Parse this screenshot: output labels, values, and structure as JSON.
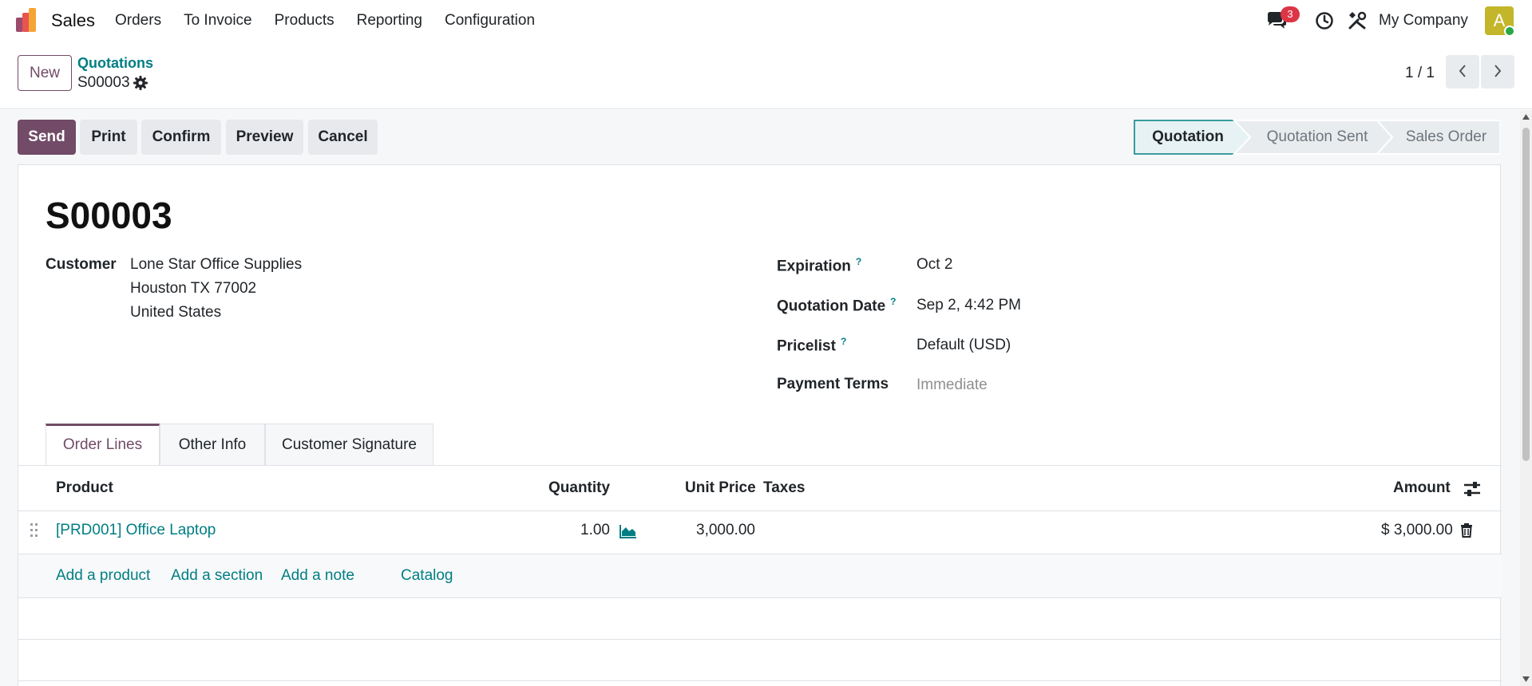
{
  "navbar": {
    "app_name": "Sales",
    "menu": [
      "Orders",
      "To Invoice",
      "Products",
      "Reporting",
      "Configuration"
    ],
    "messages_badge": "3",
    "company": "My Company",
    "avatar_letter": "A"
  },
  "control_panel": {
    "new_label": "New",
    "breadcrumb_parent": "Quotations",
    "breadcrumb_current": "S00003",
    "pager": "1 / 1"
  },
  "actions": {
    "send": "Send",
    "print": "Print",
    "confirm": "Confirm",
    "preview": "Preview",
    "cancel": "Cancel"
  },
  "statusbar": {
    "stages": [
      "Quotation",
      "Quotation Sent",
      "Sales Order"
    ],
    "active": "Quotation"
  },
  "form": {
    "title": "S00003",
    "customer_label": "Customer",
    "customer_name": "Lone Star Office Supplies",
    "customer_address_1": "Houston TX 77002",
    "customer_address_2": "United States",
    "expiration_label": "Expiration",
    "expiration_value": "Oct 2",
    "quotation_date_label": "Quotation Date",
    "quotation_date_value": "Sep 2, 4:42 PM",
    "pricelist_label": "Pricelist",
    "pricelist_value": "Default (USD)",
    "payment_terms_label": "Payment Terms",
    "payment_terms_placeholder": "Immediate",
    "help_mark": "?"
  },
  "tabs": [
    "Order Lines",
    "Other Info",
    "Customer Signature"
  ],
  "order_lines": {
    "columns": {
      "product": "Product",
      "quantity": "Quantity",
      "unit_price": "Unit Price",
      "taxes": "Taxes",
      "amount": "Amount"
    },
    "rows": [
      {
        "product": "[PRD001] Office Laptop",
        "quantity": "1.00",
        "unit_price": "3,000.00",
        "taxes": "",
        "amount": "$ 3,000.00"
      }
    ],
    "add_product": "Add a product",
    "add_section": "Add a section",
    "add_note": "Add a note",
    "catalog": "Catalog"
  },
  "colors": {
    "primary": "#714b67",
    "link": "#017e84",
    "badge": "#dc3545"
  }
}
